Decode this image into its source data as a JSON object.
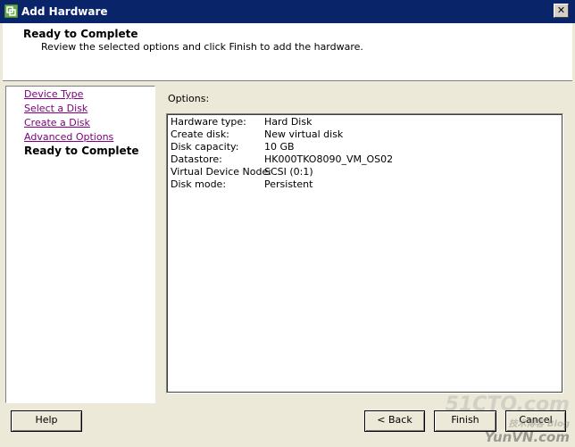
{
  "window": {
    "title": "Add Hardware"
  },
  "header": {
    "title": "Ready to Complete",
    "subtitle": "Review the selected options and click Finish to add the hardware."
  },
  "nav": {
    "items": [
      {
        "label": "Device Type",
        "state": "visited"
      },
      {
        "label": "Select a Disk",
        "state": "visited"
      },
      {
        "label": "Create a Disk",
        "state": "visited"
      },
      {
        "label": "Advanced Options",
        "state": "visited"
      },
      {
        "label": "Ready to Complete",
        "state": "current"
      }
    ]
  },
  "options": {
    "label": "Options:",
    "rows": [
      {
        "key": "Hardware type:",
        "value": "Hard Disk"
      },
      {
        "key": "Create disk:",
        "value": "New virtual disk"
      },
      {
        "key": "Disk capacity:",
        "value": "10 GB"
      },
      {
        "key": "Datastore:",
        "value": "HK000TKO8090_VM_OS02"
      },
      {
        "key": "Virtual Device Node:",
        "value": "SCSI (0:1)"
      },
      {
        "key": "Disk mode:",
        "value": "Persistent"
      }
    ]
  },
  "buttons": {
    "help": "Help",
    "back": "< Back",
    "finish": "Finish",
    "cancel": "Cancel"
  },
  "watermark": {
    "line1": "51CTO.com",
    "line2": "技术博客 Blog",
    "line3": "YunVN.com"
  },
  "colors": {
    "titlebar": "#0a246a",
    "visited_link": "#800080",
    "dialog_bg": "#ece9d8"
  }
}
